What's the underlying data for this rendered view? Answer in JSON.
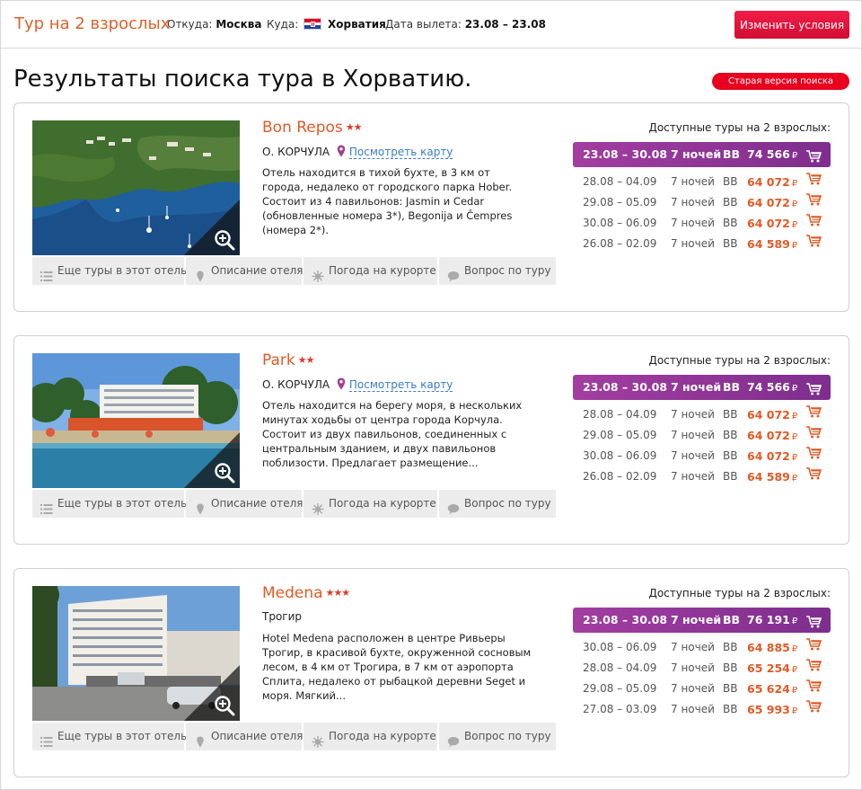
{
  "header": {
    "title": "Тур на 2 взрослых",
    "from_label": "Откуда:",
    "from_value": "Москва",
    "to_label": "Куда:",
    "to_value": "Хорватия",
    "date_label": "Дата вылета:",
    "date_value": "23.08 – 23.08",
    "change_button": "Изменить условия",
    "accent_color": "#e15a26",
    "button_color": "#e8001e"
  },
  "page_title": "Результаты поиска тура в Хорватию.",
  "old_version_button": "Старая версия поиска",
  "currency": "₽",
  "hotels": [
    {
      "name": "Bon Repos",
      "stars": "★★",
      "location": "О. КОРЧУЛА",
      "map_link": "Посмотреть карту",
      "description": "Отель находится в тихой бухте, в 3 км от города, недалеко от городского парка Hober. Состоит из 4 павильонов: Jasmin и Cedar (обновленные номера 3*), Begonija и Čempres (номера 2*).",
      "available_label": "Доступные туры на 2 взрослых:",
      "best_offer": {
        "dates": "23.08 – 30.08",
        "nights": "7 ночей",
        "meal": "BB",
        "price": "74 566"
      },
      "offers": [
        {
          "dates": "28.08 – 04.09",
          "nights": "7 ночей",
          "meal": "BB",
          "price": "64 072"
        },
        {
          "dates": "29.08 – 05.09",
          "nights": "7 ночей",
          "meal": "BB",
          "price": "64 072"
        },
        {
          "dates": "30.08 – 06.09",
          "nights": "7 ночей",
          "meal": "BB",
          "price": "64 072"
        },
        {
          "dates": "26.08 – 02.09",
          "nights": "7 ночей",
          "meal": "BB",
          "price": "64 589"
        }
      ],
      "tabs": [
        "Еще туры в этот отель",
        "Описание отеля",
        "Погода на курорте",
        "Вопрос по туру"
      ]
    },
    {
      "name": "Park",
      "stars": "★★",
      "location": "О. КОРЧУЛА",
      "map_link": "Посмотреть карту",
      "description": "Отель находится на берегу моря, в нескольких минутах ходьбы от центра города Корчула. Состоит из двух павильонов, соединенных с центральным зданием, и двух павильонов поблизости. Предлагает размещение...",
      "available_label": "Доступные туры на 2 взрослых:",
      "best_offer": {
        "dates": "23.08 – 30.08",
        "nights": "7 ночей",
        "meal": "BB",
        "price": "74 566"
      },
      "offers": [
        {
          "dates": "28.08 – 04.09",
          "nights": "7 ночей",
          "meal": "BB",
          "price": "64 072"
        },
        {
          "dates": "29.08 – 05.09",
          "nights": "7 ночей",
          "meal": "BB",
          "price": "64 072"
        },
        {
          "dates": "30.08 – 06.09",
          "nights": "7 ночей",
          "meal": "BB",
          "price": "64 072"
        },
        {
          "dates": "26.08 – 02.09",
          "nights": "7 ночей",
          "meal": "BB",
          "price": "64 589"
        }
      ],
      "tabs": [
        "Еще туры в этот отель",
        "Описание отеля",
        "Погода на курорте",
        "Вопрос по туру"
      ]
    },
    {
      "name": "Medena",
      "stars": "★★★",
      "location": "Трогир",
      "description": "Hotel Medena расположен в центре Ривьеры Трогир, в красивой бухте, окруженной сосновым лесом, в 4 км от Трогира, в 7 км от аэропорта Сплита, недалеко от рыбацкой деревни Seget и моря. Мягкий...",
      "available_label": "Доступные туры на 2 взрослых:",
      "best_offer": {
        "dates": "23.08 – 30.08",
        "nights": "7 ночей",
        "meal": "BB",
        "price": "76 191"
      },
      "offers": [
        {
          "dates": "30.08 – 06.09",
          "nights": "7 ночей",
          "meal": "BB",
          "price": "64 885"
        },
        {
          "dates": "28.08 – 04.09",
          "nights": "7 ночей",
          "meal": "BB",
          "price": "65 254"
        },
        {
          "dates": "29.08 – 05.09",
          "nights": "7 ночей",
          "meal": "BB",
          "price": "65 624"
        },
        {
          "dates": "27.08 – 03.09",
          "nights": "7 ночей",
          "meal": "BB",
          "price": "65 993"
        }
      ],
      "tabs": [
        "Еще туры в этот отель",
        "Описание отеля",
        "Погода на курорте",
        "Вопрос по туру"
      ]
    }
  ]
}
